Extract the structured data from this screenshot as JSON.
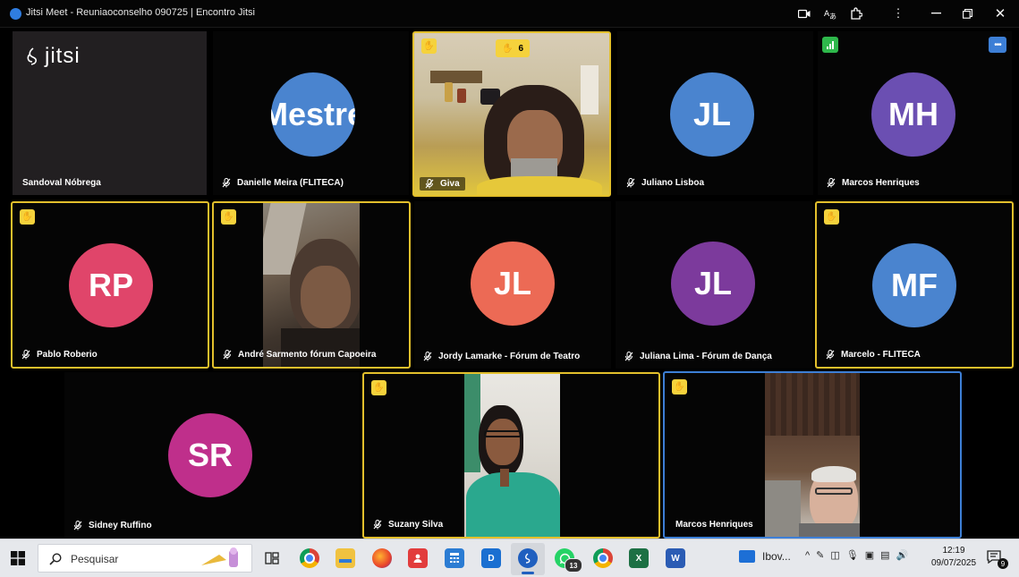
{
  "window": {
    "title": "Jitsi Meet - Reuniaoconselho 090725 | Encontro Jitsi"
  },
  "tiles": [
    {
      "name": "Sandoval Nóbrega",
      "watermark": "jitsi"
    },
    {
      "name": "Danielle Meira (FLITECA)",
      "avatar_text": "Mestre",
      "avatar_color": "#4a84cf"
    },
    {
      "name": "Giva",
      "raised_hand": true,
      "raised_count": "6"
    },
    {
      "name": "Juliano Lisboa",
      "avatar_text": "JL",
      "avatar_color": "#4a84cf"
    },
    {
      "name": "Marcos Henriques",
      "avatar_text": "MH",
      "avatar_color": "#6b4fb2"
    },
    {
      "name": "Pablo Roberio",
      "avatar_text": "RP",
      "avatar_color": "#e0456a",
      "raised_hand": true
    },
    {
      "name": "André Sarmento fórum Capoeira",
      "raised_hand": true
    },
    {
      "name": "Jordy Lamarke - Fórum de Teatro",
      "avatar_text": "JL",
      "avatar_color": "#ec6a55"
    },
    {
      "name": "Juliana Lima - Fórum de Dança",
      "avatar_text": "JL",
      "avatar_color": "#7c3a9c"
    },
    {
      "name": "Marcelo - FLITECA",
      "avatar_text": "MF",
      "avatar_color": "#4a84cf",
      "raised_hand": true
    },
    {
      "name": "Sidney Ruffino",
      "avatar_text": "SR",
      "avatar_color": "#bf2f8b"
    },
    {
      "name": "Suzany Silva",
      "raised_hand": true
    },
    {
      "name": "Marcos Henriques",
      "raised_hand": true,
      "active_speaker": true
    }
  ],
  "taskbar": {
    "search_placeholder": "Pesquisar",
    "whatsapp_badge": "13",
    "weather_label": "Ibov...",
    "time": "12:19",
    "date": "09/07/2025",
    "notification_badge": "9"
  },
  "colors": {
    "raised_hand_border": "#e3c02c",
    "active_speaker_border": "#3d7fd6"
  }
}
